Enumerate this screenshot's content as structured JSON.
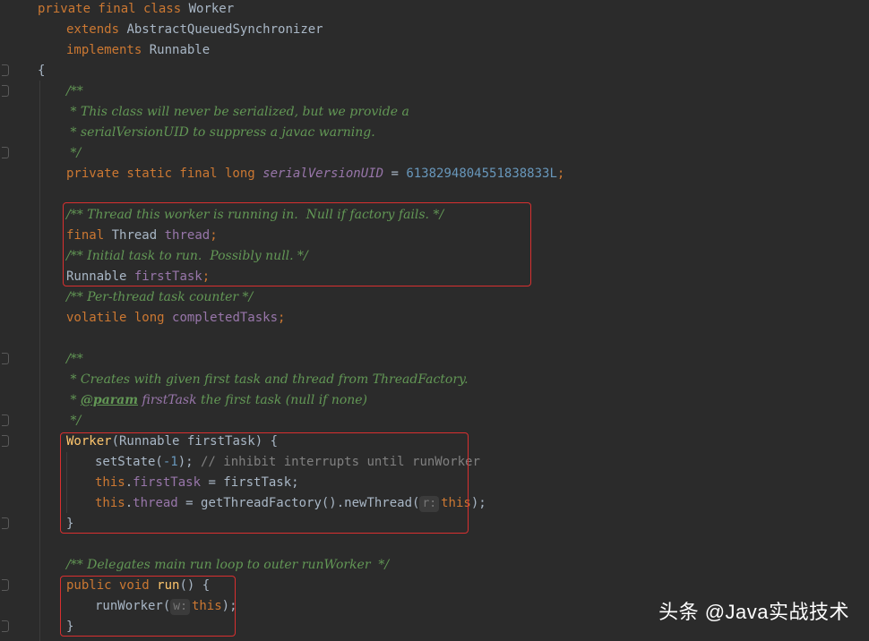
{
  "code": {
    "l1": {
      "kw1": "private final class",
      "name": "Worker"
    },
    "l2": {
      "kw": "extends",
      "name": "AbstractQueuedSynchronizer"
    },
    "l3": {
      "kw": "implements",
      "name": "Runnable"
    },
    "l4": "{",
    "l5": "/**",
    "l6": " * This class will never be serialized, but we provide a",
    "l7": " * serialVersionUID to suppress a javac warning.",
    "l8": " */",
    "l9": {
      "kw": "private static final long",
      "field": "serialVersionUID",
      "eq": " = ",
      "num": "6138294804551838833L",
      "semi": ";"
    },
    "l10": "/** Thread this worker is running in.  Null if factory fails. */",
    "l11": {
      "kw": "final",
      "type": "Thread",
      "field": "thread",
      "semi": ";"
    },
    "l12": "/** Initial task to run.  Possibly null. */",
    "l13": {
      "type": "Runnable",
      "field": "firstTask",
      "semi": ";"
    },
    "l14": "/** Per-thread task counter */",
    "l15": {
      "kw": "volatile long",
      "field": "completedTasks",
      "semi": ";"
    },
    "l16": "/**",
    "l17": " * Creates with given first task and thread from ThreadFactory.",
    "l18": {
      "pre": " * ",
      "tag": "@param",
      "param": "firstTask",
      "rest": " the first task (null if none)"
    },
    "l19": " */",
    "l20": {
      "fn": "Worker",
      "rest": "(Runnable firstTask) {"
    },
    "l21": {
      "call": "setState(",
      "num": "-1",
      "close": ");",
      "comment": " // inhibit interrupts until runWorker"
    },
    "l22": {
      "kw": "this",
      "dot": ".",
      "field": "firstTask",
      "rest": " = firstTask;"
    },
    "l23": {
      "kw": "this",
      "dot": ".",
      "field": "thread",
      "rest": " = getThreadFactory().newThread(",
      "hint": "r:",
      "kw2": "this",
      "close": ");"
    },
    "l24": "}",
    "l25": "/** Delegates main run loop to outer runWorker  */",
    "l26": {
      "kw": "public void",
      "fn": "run",
      "rest": "() {"
    },
    "l27": {
      "call": "runWorker(",
      "hint": "w:",
      "kw": "this",
      "close": ");"
    },
    "l28": "}"
  },
  "watermark": "头条 @Java实战技术"
}
